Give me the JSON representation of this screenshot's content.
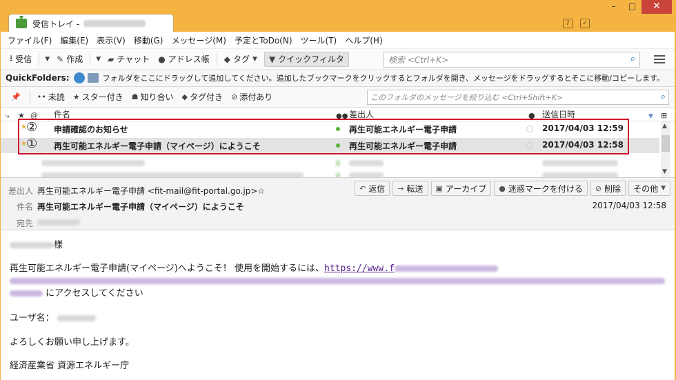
{
  "window": {
    "tab_title": "受信トレイ -",
    "controls": {
      "minimize": "–",
      "maximize": "□",
      "close": "✕"
    }
  },
  "menu": [
    "ファイル(F)",
    "編集(E)",
    "表示(V)",
    "移動(G)",
    "メッセージ(M)",
    "予定とToDo(N)",
    "ツール(T)",
    "ヘルプ(H)"
  ],
  "toolbar": {
    "get_mail": "受信",
    "write": "作成",
    "chat": "チャット",
    "address_book": "アドレス帳",
    "tag": "タグ",
    "quick_filter": "クイックフィルタ",
    "search_placeholder": "検索 <Ctrl+K>"
  },
  "quickfolders": {
    "label": "QuickFolders:",
    "hint": "フォルダをここにドラッグして追加してください。追加したブックマークをクリックするとフォルダを開き、メッセージをドラッグするとそこに移動/コピーします。"
  },
  "filterbar": {
    "unread": "未読",
    "starred": "スター付き",
    "contact": "知り合い",
    "tagged": "タグ付き",
    "attachment": "添付あり",
    "placeholder": "このフォルダのメッセージを絞り込む <Ctrl+Shift+K>"
  },
  "thread": {
    "columns": {
      "subject": "件名",
      "sender": "差出人",
      "date": "送信日時"
    },
    "rows": [
      {
        "marker": "②",
        "subject": "申請確認のお知らせ",
        "sender": "再生可能エネルギー電子申請",
        "date": "2017/04/03 12:59"
      },
      {
        "marker": "①",
        "subject": "再生可能エネルギー電子申請（マイページ）にようこそ",
        "sender": "再生可能エネルギー電子申請",
        "date": "2017/04/03 12:58"
      }
    ]
  },
  "message": {
    "from_label": "差出人",
    "from": "再生可能エネルギー電子申請 <fit-mail@fit-portal.go.jp>☆",
    "subject_label": "件名",
    "subject": "再生可能エネルギー電子申請（マイページ）にようこそ",
    "to_label": "宛先",
    "date": "2017/04/03 12:58",
    "actions": [
      "返信",
      "転送",
      "アーカイブ",
      "迷惑マークを付ける",
      "削除",
      "その他"
    ]
  },
  "body": {
    "salutation_suffix": "様",
    "line1": "再生可能エネルギー電子申請(マイページ)へようこそ！ 使用を開始するには、",
    "link_start": "https://www.f",
    "line2_suffix": "にアクセスしてください",
    "user_label": "ユーザ名：",
    "closing": "よろしくお願い申し上げます。",
    "signature": "経済産業省 資源エネルギー庁"
  }
}
